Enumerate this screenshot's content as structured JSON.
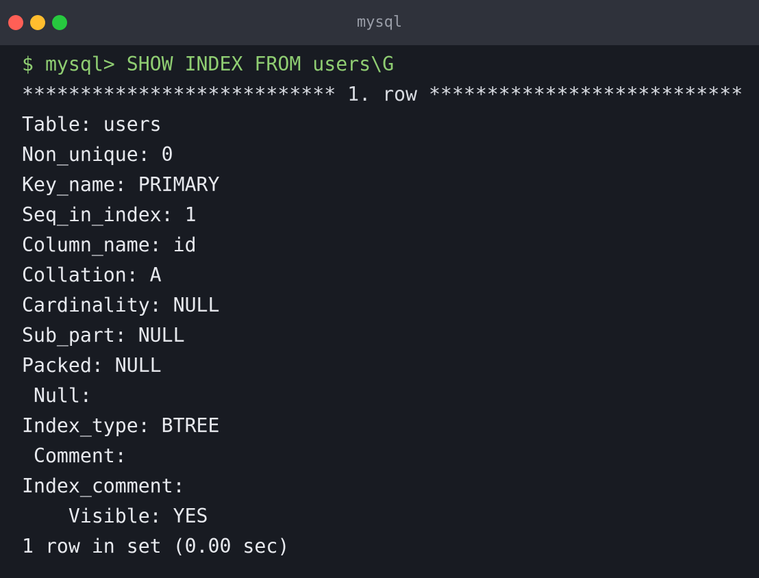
{
  "window": {
    "title": "mysql",
    "controls": {
      "close_color": "#ff5f56",
      "minimize_color": "#ffbd2e",
      "maximize_color": "#27c93f"
    }
  },
  "terminal": {
    "prompt_line": "$ mysql> SHOW INDEX FROM users\\G",
    "row_separator": "*************************** 1. row ***************************",
    "fields": [
      "Table: users",
      "Non_unique: 0",
      "Key_name: PRIMARY",
      "Seq_in_index: 1",
      "Column_name: id",
      "Collation: A",
      "Cardinality: NULL",
      "Sub_part: NULL",
      "Packed: NULL",
      " Null:",
      "Index_type: BTREE",
      " Comment:",
      "Index_comment:",
      "    Visible: YES"
    ],
    "summary": "1 row in set (0.00 sec)"
  },
  "colors": {
    "background": "#181b22",
    "titlebar": "#2f323b",
    "prompt": "#8fcd72",
    "text": "#e7e9ee"
  }
}
